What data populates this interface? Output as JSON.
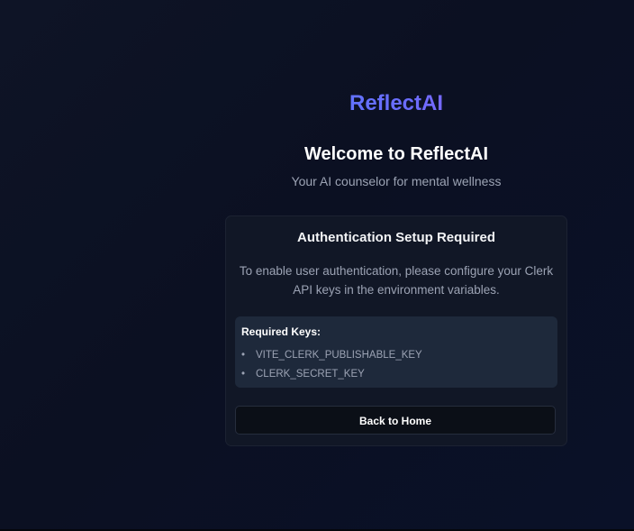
{
  "brand": {
    "name": "ReflectAI"
  },
  "header": {
    "title": "Welcome to ReflectAI",
    "subtitle": "Your AI counselor for mental wellness"
  },
  "card": {
    "title": "Authentication Setup Required",
    "description": "To enable user authentication, please configure your Clerk API keys in the environment variables.",
    "keys_title": "Required Keys:",
    "keys": [
      "VITE_CLERK_PUBLISHABLE_KEY",
      "CLERK_SECRET_KEY"
    ],
    "button_label": "Back to Home"
  },
  "colors": {
    "background": "#0b1022",
    "card": "#111726",
    "keys_box": "#1e293b",
    "brand_gradient_start": "#4f7dff",
    "brand_gradient_end": "#a05cff"
  }
}
